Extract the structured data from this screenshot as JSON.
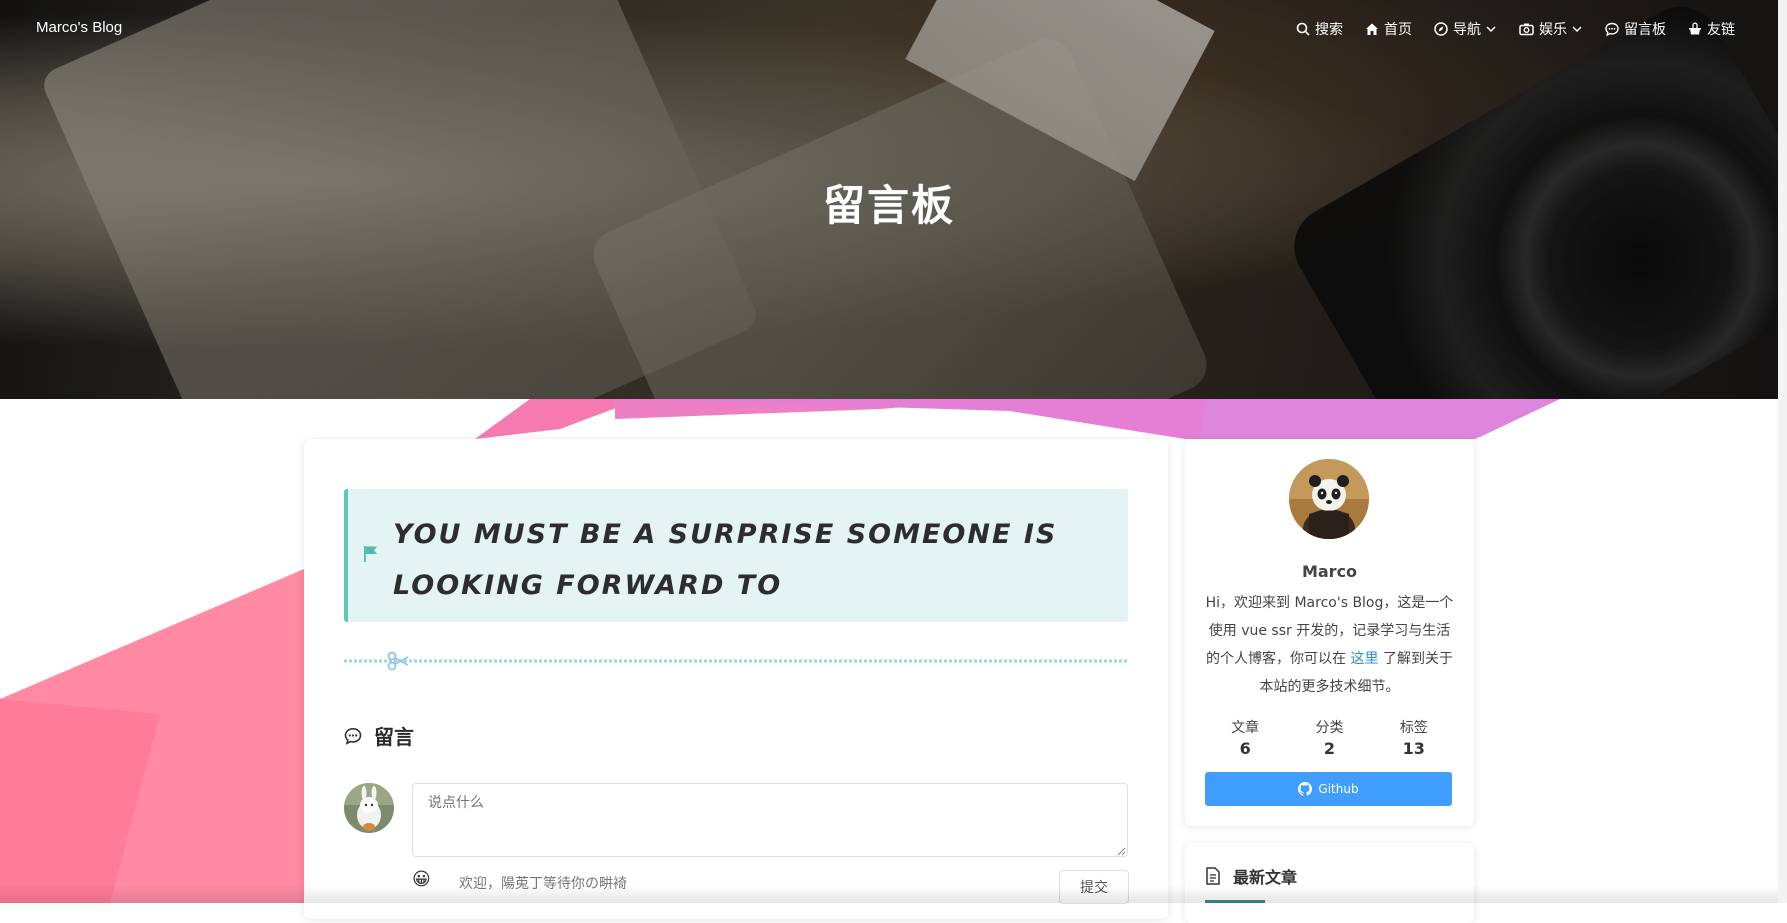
{
  "nav": {
    "brand": "Marco's Blog",
    "items": [
      {
        "label": "搜索",
        "icon": "search-icon"
      },
      {
        "label": "首页",
        "icon": "home-icon"
      },
      {
        "label": "导航",
        "icon": "compass-icon",
        "dropdown": true
      },
      {
        "label": "娱乐",
        "icon": "camera-icon",
        "dropdown": true
      },
      {
        "label": "留言板",
        "icon": "chat-icon"
      },
      {
        "label": "友链",
        "icon": "link-icon"
      }
    ]
  },
  "hero": {
    "title": "留言板"
  },
  "main": {
    "quote": "You must be a surprise someone is looking forward to",
    "section_title": "留言",
    "comment_placeholder": "说点什么",
    "welcome": "欢迎，陽莵丁等待你の畊裿",
    "submit_label": "提交"
  },
  "profile": {
    "name": "Marco",
    "desc_before": "Hi，欢迎来到 Marco's Blog，这是一个使用 vue ssr 开发的，记录学习与生活的个人博客，你可以在 ",
    "desc_link": "这里",
    "desc_after": " 了解到关于本站的更多技术细节。",
    "stats": [
      {
        "label": "文章",
        "value": "6"
      },
      {
        "label": "分类",
        "value": "2"
      },
      {
        "label": "标签",
        "value": "13"
      }
    ],
    "github_label": "Github"
  },
  "latest": {
    "title": "最新文章"
  },
  "colors": {
    "accent": "#409eff",
    "quote_bg": "#e3f4f2",
    "quote_border": "#5fc7b8",
    "pink": "#ff7fa0",
    "magenta": "#e979d8"
  }
}
